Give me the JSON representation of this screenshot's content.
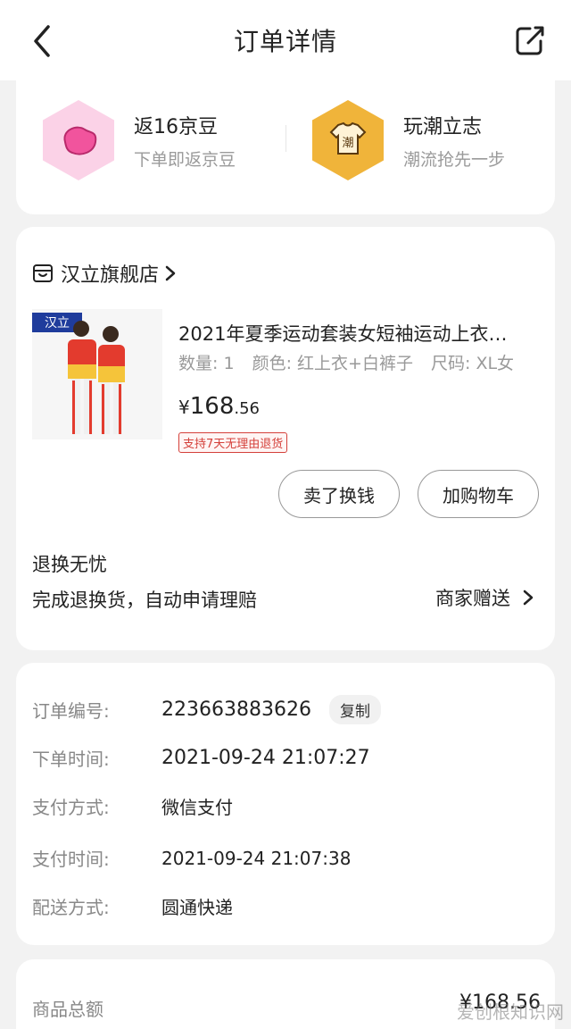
{
  "header": {
    "title": "订单详情"
  },
  "promos": [
    {
      "title": "返16京豆",
      "subtitle": "下单即返京豆",
      "icon": "bean-icon",
      "color": "#fbd2e7"
    },
    {
      "title": "玩潮立志",
      "subtitle": "潮流抢先一步",
      "icon": "trend-icon",
      "color": "#f0b43a",
      "icon_text": "潮"
    }
  ],
  "store": {
    "name": "汉立旗舰店",
    "logo_text": "汉立"
  },
  "product": {
    "title": "2021年夏季运动套装女短袖运动上衣…",
    "quantity": "数量: 1",
    "color": "颜色: 红上衣+白裤子",
    "size": "尺码: XL女",
    "price_symbol": "¥",
    "price_int": "168",
    "price_dec": ".56",
    "return_tag": "支持7天无理由退货"
  },
  "buttons": {
    "sell": "卖了换钱",
    "cart": "加购物车"
  },
  "service": {
    "title": "退换无忧",
    "desc": "完成退换货，自动申请理赔",
    "gift": "商家赠送"
  },
  "order_info": {
    "number_label": "订单编号:",
    "number": "223663883626",
    "copy": "复制",
    "time_label": "下单时间:",
    "time": "2021-09-24 21:07:27",
    "pay_method_label": "支付方式:",
    "pay_method": "微信支付",
    "pay_time_label": "支付时间:",
    "pay_time": "2021-09-24 21:07:38",
    "delivery_label": "配送方式:",
    "delivery": "圆通快递"
  },
  "totals": {
    "goods_label": "商品总额",
    "goods_value": "¥168.56"
  },
  "watermark": "爱创根知识网"
}
